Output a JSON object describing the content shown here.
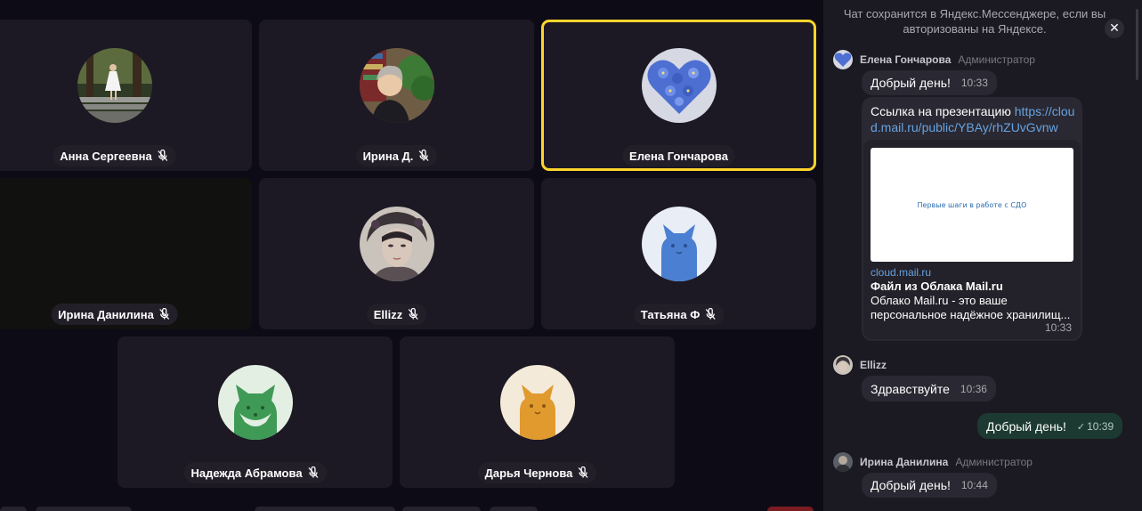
{
  "participants": [
    {
      "name": "Анна Сергеевна",
      "muted": true,
      "avatar": "photo-girl-white-dress"
    },
    {
      "name": "Ирина Д.",
      "muted": true,
      "avatar": "photo-woman-indoor"
    },
    {
      "name": "Елена Гончарова",
      "muted": false,
      "speaking": true,
      "avatar": "blue-flowers-heart"
    },
    {
      "name": "Ирина Данилина",
      "muted": true,
      "avatar": "camera-dark"
    },
    {
      "name": "Ellizz",
      "muted": true,
      "avatar": "fantasy-portrait"
    },
    {
      "name": "Татьяна Ф",
      "muted": true,
      "avatar": "cat-blue"
    },
    {
      "name": "Надежда Абрамова",
      "muted": true,
      "avatar": "fox-green"
    },
    {
      "name": "Дарья Чернова",
      "muted": true,
      "avatar": "cat-orange"
    }
  ],
  "colors": {
    "active_speaker_border": "#fed42b",
    "link": "#67a3e0",
    "own_message_bg": "#1c3a31"
  },
  "chat": {
    "notice": "Чат сохранится в Яндекс.Мессенджере, если вы авторизованы на Яндексе.",
    "close_icon": "close-icon",
    "messages": [
      {
        "author": "Елена Гончарова",
        "role": "Администратор",
        "items": [
          {
            "text": "Добрый день!",
            "time": "10:33"
          },
          {
            "text_prefix": "Ссылка на презентацию ",
            "url": "https://cloud.mail.ru/public/YBAy/rhZUvGvnw",
            "preview": {
              "image_caption": "Первые шаги в работе с СДО",
              "domain": "cloud.mail.ru",
              "title": "Файл из Облака Mail.ru",
              "description": "Облако Mail.ru - это ваше персональное надёжное хранилищ...",
              "time": "10:33"
            }
          }
        ]
      },
      {
        "author": "Ellizz",
        "role": "",
        "items": [
          {
            "text": "Здравствуйте",
            "time": "10:36"
          }
        ]
      },
      {
        "author": "me",
        "own": true,
        "items": [
          {
            "text": "Добрый день!",
            "time": "10:39",
            "status": "read-check"
          }
        ]
      },
      {
        "author": "Ирина Данилина",
        "role": "Администратор",
        "items": [
          {
            "text": "Добрый день!",
            "time": "10:44"
          }
        ]
      }
    ]
  }
}
